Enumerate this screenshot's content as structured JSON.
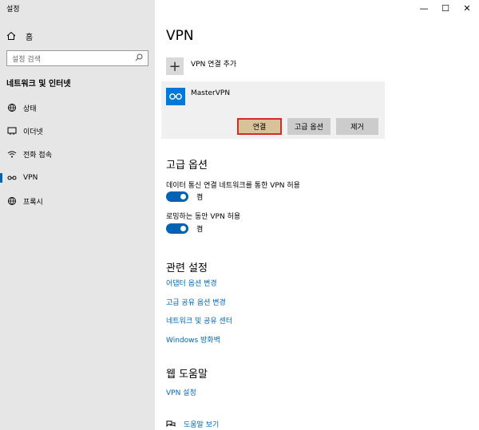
{
  "window": {
    "title": "설정",
    "controls": {
      "minimize": "—",
      "maximize": "☐",
      "close": "✕"
    }
  },
  "sidebar": {
    "home_label": "홈",
    "search_placeholder": "설정 검색",
    "section_title": "네트워크 및 인터넷",
    "items": [
      {
        "label": "상태",
        "icon": "globe-status-icon"
      },
      {
        "label": "이더넷",
        "icon": "ethernet-icon"
      },
      {
        "label": "전화 접속",
        "icon": "dialup-icon"
      },
      {
        "label": "VPN",
        "icon": "vpn-icon",
        "selected": true
      },
      {
        "label": "프록시",
        "icon": "globe-icon"
      }
    ]
  },
  "main": {
    "title": "VPN",
    "add_vpn_label": "VPN 연결 추가",
    "vpn_entry": {
      "name": "MasterVPN",
      "buttons": {
        "connect": "연결",
        "advanced": "고급 옵션",
        "remove": "제거"
      }
    },
    "advanced_options": {
      "heading": "고급 옵션",
      "metered": {
        "label": "데이터 통신 연결 네트워크를 통한 VPN 허용",
        "state": "켬"
      },
      "roaming": {
        "label": "로밍하는 동안 VPN 허용",
        "state": "켬"
      }
    },
    "related_settings": {
      "heading": "관련 설정",
      "links": [
        "어댑터 옵션 변경",
        "고급 공유 옵션 변경",
        "네트워크 및 공유 센터",
        "Windows 방화벽"
      ]
    },
    "web_help": {
      "heading": "웹 도움말",
      "links": [
        "VPN 설정"
      ]
    },
    "get_help_label": "도움말 보기"
  },
  "colors": {
    "accent": "#0063b1",
    "link": "#0067b8",
    "sidebar_bg": "#e6e6e6",
    "highlight_border": "#d42a2a"
  }
}
